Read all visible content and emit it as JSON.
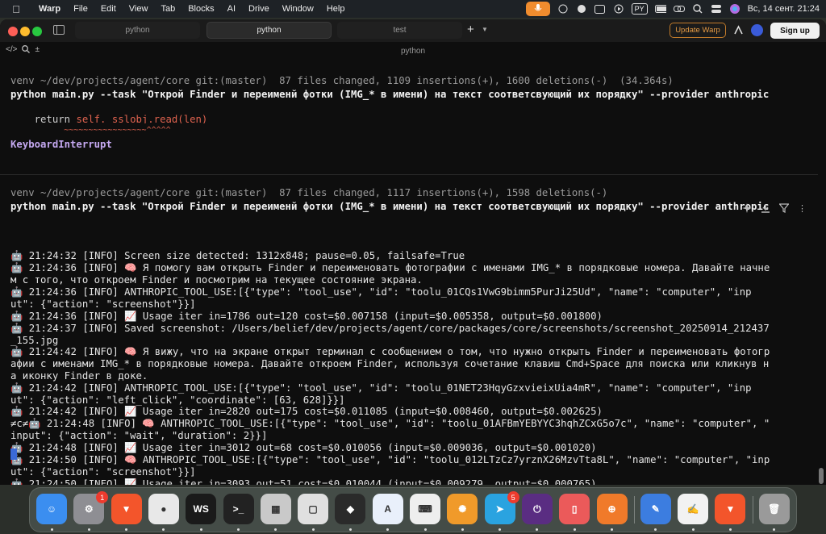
{
  "menubar": {
    "app": "Warp",
    "items": [
      "File",
      "Edit",
      "View",
      "Tab",
      "Blocks",
      "AI",
      "Drive",
      "Window",
      "Help"
    ],
    "input_source": "PY",
    "clock": "Вс, 14 сент.  21:24"
  },
  "tabs": [
    {
      "label": "python"
    },
    {
      "label": "python"
    },
    {
      "label": "test"
    }
  ],
  "titlebar": {
    "update_label": "Update Warp",
    "signup_label": "Sign up"
  },
  "pane_title": "python",
  "blocks": [
    {
      "prompt": "venv ~/dev/projects/agent/core git:(master)  87 files changed, 1109 insertions(+), 1600 deletions(-)  (34.364s)",
      "command": "python main.py --task \"Открой Finder и переименй фотки (IMG_* в имени) на текст соответсвующий их порядку\" --provider anthropic",
      "trace_return": "    return ",
      "trace_call": "self._sslobj.read(len)",
      "trace_carets": "           ~~~~~~~~~~~~~~~~~^^^^^",
      "error": "KeyboardInterrupt"
    },
    {
      "prompt": "venv ~/dev/projects/agent/core git:(master)  87 files changed, 1117 insertions(+), 1598 deletions(-)",
      "command": "python main.py --task \"Открой Finder и переименй фотки (IMG_* в имени) на текст соответсвующий их порядку\" --provider anthropic"
    }
  ],
  "log_lines": [
    "🤖 21:24:32 [INFO] Screen size detected: 1312x848; pause=0.05, failsafe=True",
    "🤖 21:24:36 [INFO] 🧠 Я помогу вам открыть Finder и переименовать фотографии с именами IMG_* в порядковые номера. Давайте начне",
    "м с того, что откроем Finder и посмотрим на текущее состояние экрана.",
    "🤖 21:24:36 [INFO] ANTHROPIC_TOOL_USE:[{\"type\": \"tool_use\", \"id\": \"toolu_01CQs1VwG9bimm5PurJi25Ud\", \"name\": \"computer\", \"inp",
    "ut\": {\"action\": \"screenshot\"}}]",
    "🤖 21:24:36 [INFO] 📈 Usage iter in=1786 out=120 cost=$0.007158 (input=$0.005358, output=$0.001800)",
    "🤖 21:24:37 [INFO] Saved screenshot: /Users/belief/dev/projects/agent/core/packages/core/screenshots/screenshot_20250914_212437",
    "_155.jpg",
    "🤖 21:24:42 [INFO] 🧠 Я вижу, что на экране открыт терминал с сообщением о том, что нужно открыть Finder и переименовать фотогр",
    "афии с именами IMG_* в порядковые номера. Давайте откроем Finder, используя сочетание клавиш Cmd+Space для поиска или кликнув н",
    "а иконку Finder в доке.",
    "🤖 21:24:42 [INFO] ANTHROPIC_TOOL_USE:[{\"type\": \"tool_use\", \"id\": \"toolu_01NET23HqyGzxvieixUia4mR\", \"name\": \"computer\", \"inp",
    "ut\": {\"action\": \"left_click\", \"coordinate\": [63, 628]}}]",
    "🤖 21:24:42 [INFO] 📈 Usage iter in=2820 out=175 cost=$0.011085 (input=$0.008460, output=$0.002625)",
    "≠c≠🤖 21:24:48 [INFO] 🧠 ANTHROPIC_TOOL_USE:[{\"type\": \"tool_use\", \"id\": \"toolu_01AFBmYEBYYC3hqhZCxG5o7c\", \"name\": \"computer\", \"",
    "input\": {\"action\": \"wait\", \"duration\": 2}}]",
    "🤖 21:24:48 [INFO] 📈 Usage iter in=3012 out=68 cost=$0.010056 (input=$0.009036, output=$0.001020)",
    "🤖 21:24:50 [INFO] 🧠 ANTHROPIC_TOOL_USE:[{\"type\": \"tool_use\", \"id\": \"toolu_012LTzCz7yrznX26MzvTta8L\", \"name\": \"computer\", \"inp",
    "ut\": {\"action\": \"screenshot\"}}]",
    "🤖 21:24:50 [INFO] 📈 Usage iter in=3093 out=51 cost=$0.010044 (input=$0.009279, output=$0.000765)"
  ],
  "dock": {
    "icons": [
      {
        "name": "finder-icon",
        "color": "#3b8ef0",
        "glyph": "☺"
      },
      {
        "name": "system-settings-icon",
        "color": "#8e8e93",
        "glyph": "⚙",
        "badge": "1"
      },
      {
        "name": "brave-icon",
        "color": "#f3552b",
        "glyph": "▼"
      },
      {
        "name": "chrome-icon",
        "color": "#e8e8e8",
        "glyph": "●"
      },
      {
        "name": "webstorm-icon",
        "color": "#1a1a1a",
        "glyph": "WS"
      },
      {
        "name": "terminal-icon",
        "color": "#222222",
        "glyph": ">_"
      },
      {
        "name": "launchpad-icon",
        "color": "#c9c9c9",
        "glyph": "▦"
      },
      {
        "name": "notes-app-icon",
        "color": "#e0e0e0",
        "glyph": "▢"
      },
      {
        "name": "cube-app-icon",
        "color": "#2a2a2a",
        "glyph": "◆"
      },
      {
        "name": "xcode-icon",
        "color": "#e9f0fb",
        "glyph": "A"
      },
      {
        "name": "keyboard-icon",
        "color": "#eeeeee",
        "glyph": "⌨"
      },
      {
        "name": "chatgpt-icon",
        "color": "#f09a2a",
        "glyph": "✺"
      },
      {
        "name": "telegram-icon",
        "color": "#2aa3e0",
        "glyph": "➤",
        "badge": "5"
      },
      {
        "name": "power-app-icon",
        "color": "#5a2d82",
        "glyph": "⏻"
      },
      {
        "name": "phone-mirror-icon",
        "color": "#eb5a5a",
        "glyph": "▯"
      },
      {
        "name": "vpn-lock-icon",
        "color": "#f07a2a",
        "glyph": "⊕"
      },
      {
        "name": "xcode-toolbox-icon",
        "color": "#3c7de0",
        "glyph": "✎"
      },
      {
        "name": "textedit-icon",
        "color": "#f2f2f2",
        "glyph": "✍"
      },
      {
        "name": "brave-beta-icon",
        "color": "#f3552b",
        "glyph": "▼"
      },
      {
        "name": "trash-icon",
        "color": "#9a9a9a",
        "glyph": "🗑"
      }
    ]
  }
}
